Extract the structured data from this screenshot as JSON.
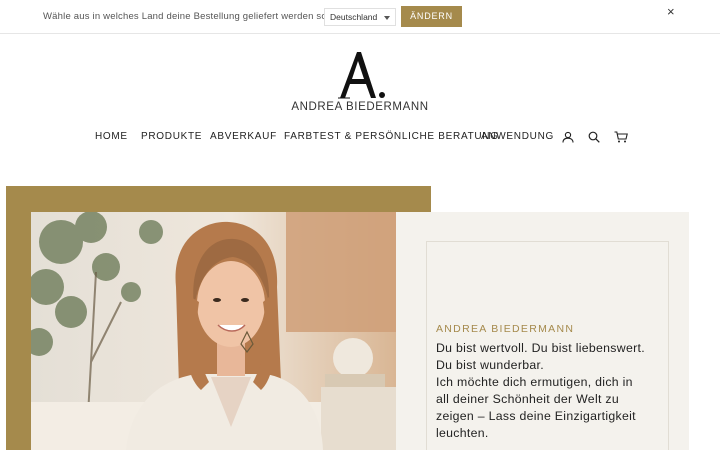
{
  "country_bar": {
    "prompt": "Wähle aus in welches Land deine Bestellung geliefert werden soll:",
    "selected_country": "Deutschland",
    "change_label": "ÄNDERN",
    "close_label": "×"
  },
  "brand": {
    "name": "ANDREA BIEDERMANN",
    "accent_color": "#a58a4c"
  },
  "nav": {
    "items": [
      "HOME",
      "PRODUKTE",
      "ABVERKAUF",
      "FARBTEST & PERSÖNLICHE BERATUNG",
      "ANWENDUNG"
    ],
    "icons": [
      "account-icon",
      "search-icon",
      "cart-icon"
    ]
  },
  "hero": {
    "name": "ANDREA BIEDERMANN",
    "lines": [
      "Du bist wertvoll. Du bist liebenswert.",
      "Du bist wunderbar.",
      "Ich möchte dich ermutigen, dich in",
      "all deiner Schönheit der Welt zu",
      "zeigen – Lass deine Einzigartigkeit",
      "leuchten."
    ]
  }
}
